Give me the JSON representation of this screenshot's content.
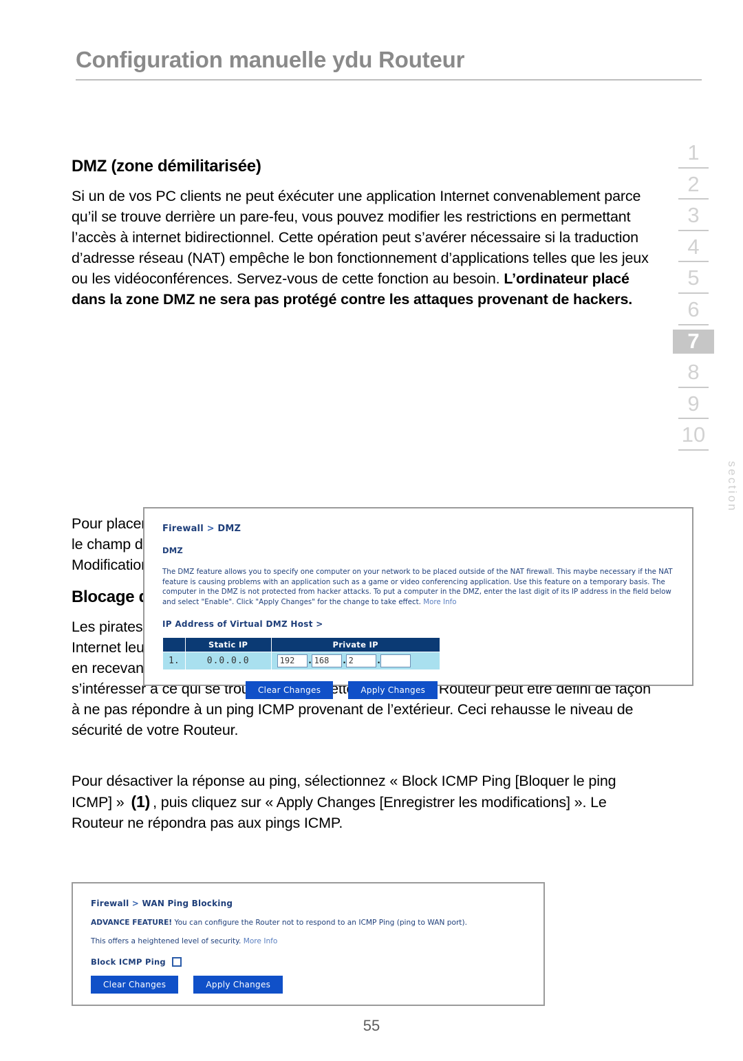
{
  "header": {
    "title": "Configuration manuelle ydu Routeur"
  },
  "section_rail": {
    "label": "section",
    "items": [
      "1",
      "2",
      "3",
      "4",
      "5",
      "6",
      "7",
      "8",
      "9",
      "10"
    ],
    "active": "7",
    "active_bg": "#c6c6c6",
    "inactive_color": "#d2d2d2"
  },
  "content": {
    "dmz_heading": "DMZ (zone démilitarisée)",
    "dmz_para_normal": "Si un de vos PC clients ne peut éxécuter une application Internet convenablement parce qu’il se trouve derrière un pare-feu, vous pouvez modifier les restrictions en permettant l’accès à internet bidirectionnel. Cette opération peut s’avérer nécessaire si la traduction d’adresse réseau (NAT) empêche le bon fonctionnement d’applications telles que les jeux ou les vidéoconférences. Servez-vous de cette fonction au besoin. ",
    "dmz_para_bold": "L’ordinateur placé dans la zone DMZ ne sera pas protégé contre les attaques provenant de hackers.",
    "dmz_after_para": "Pour placer un ordinateur dans la zone DMZ, entrez son adresse IP de réseau local dans le champ de saisie d’IP privée, et cliquez sur « Apply Changes [Enregistrer les Modifications] » pour que celles-ci soient prises en compte.",
    "icmp_heading": "Blocage du ping ICMP",
    "icmp_para": "Les pirates informatiques utilisent une technique appelée Pinging pour dénicher sur Internet leurs victimes potentielles. En faisant un ping vers une adresse IP particulière et en recevant une réponse de la part de celle-ci, un pirate informatique peut décider de s’intéresser à ce qui se trouve derrière cette adresse. Le Routeur peut être défini de façon à ne pas répondre à un ping ICMP provenant de l’extérieur. Ceci rehausse le niveau de sécurité de votre Routeur.",
    "icmp_instr_part1": "Pour désactiver la réponse au ping, sélectionnez « Block ICMP Ping [Bloquer le ping ICMP] » ",
    "icmp_instr_callout": "(1)",
    "icmp_instr_part2": ", puis cliquez sur « Apply Changes [Enregistrer les modifications] ». Le Routeur ne répondra pas aux pings ICMP."
  },
  "dmz_screenshot": {
    "breadcrumb_root": "Firewall",
    "breadcrumb_sep": ">",
    "breadcrumb_leaf": "DMZ",
    "panel_title": "DMZ",
    "description": "The DMZ feature allows you to specify one computer on your network to be placed outside of the NAT firewall. This maybe necessary if the NAT feature is causing problems with an application such as a game or video conferencing application. Use this feature on a temporary basis. The computer in the DMZ is not protected from hacker attacks. To put a computer in the DMZ, enter the last digit of its IP address in the field below and select \"Enable\". Click \"Apply Changes\" for the change to take effect. ",
    "more_info": "More Info",
    "field_label": "IP Address of Virtual DMZ Host >",
    "table": {
      "headers": [
        "",
        "Static IP",
        "Private IP"
      ],
      "row_index": "1.",
      "static_ip": "0.0.0.0",
      "private_ip_octets": [
        "192",
        "168",
        "2",
        ""
      ]
    },
    "buttons": {
      "clear": "Clear Changes",
      "apply": "Apply Changes",
      "color": "#1050c8"
    }
  },
  "wan_screenshot": {
    "breadcrumb_root": "Firewall",
    "breadcrumb_sep": ">",
    "breadcrumb_leaf": "WAN Ping Blocking",
    "advance_label": "ADVANCE FEATURE!",
    "advance_text": " You can configure the Router not to respond to an ICMP Ping (ping to WAN port).",
    "security_text": "This offers a heightened level of security. ",
    "more_info": "More Info",
    "checkbox_label": "Block ICMP Ping",
    "checkbox_checked": false,
    "buttons": {
      "clear": "Clear Changes",
      "apply": "Apply Changes",
      "color": "#1050c8"
    }
  },
  "footer": {
    "page_number": "55"
  }
}
